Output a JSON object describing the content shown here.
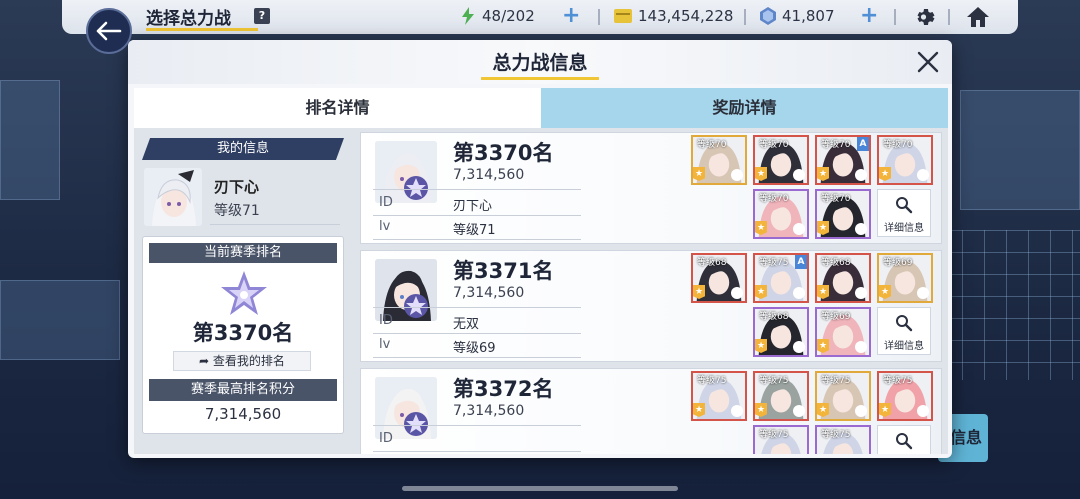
{
  "topbar": {
    "title": "选择总力战",
    "help": "?",
    "stamina": "48/202",
    "credits": "143,454,228",
    "gems": "41,807"
  },
  "modal": {
    "title": "总力战信息",
    "tabs": [
      {
        "label": "排名详情",
        "active": true
      },
      {
        "label": "奖励详情",
        "active": false
      }
    ]
  },
  "my_info": {
    "header": "我的信息",
    "name": "刃下心",
    "level": "等级71",
    "season_rank_header": "当前赛季排名",
    "season_rank": "第3370名",
    "view_button": "查看我的排名",
    "best_header": "赛季最高排名积分",
    "best_score": "7,314,560"
  },
  "rank_list": [
    {
      "rank": "第3370名",
      "score": "7,314,560",
      "id_label": "ID",
      "id_value": "刃下心",
      "lv_label": "lv",
      "lv_value": "等级71",
      "characters": [
        {
          "level": "等级70",
          "border": "#e0a93a",
          "color": "#d8c6b5"
        },
        {
          "level": "等级70",
          "border": "#d5544a",
          "color": "#2f2f3a"
        },
        {
          "level": "等级70",
          "border": "#d5544a",
          "color": "#3a2d3a",
          "badge": "A"
        },
        {
          "level": "等级70",
          "border": "#d5544a",
          "color": "#cfd5e6"
        },
        {
          "level": "等级70",
          "border": "#9b6ad0",
          "color": "#f0b4bb"
        },
        {
          "level": "等级70",
          "border": "#9b6ad0",
          "color": "#25262d"
        }
      ],
      "detail": "详细信息"
    },
    {
      "rank": "第3371名",
      "score": "7,314,560",
      "id_label": "ID",
      "id_value": "无双",
      "lv_label": "lv",
      "lv_value": "等级69",
      "characters": [
        {
          "level": "等级68",
          "border": "#d5544a",
          "color": "#2f2f3a"
        },
        {
          "level": "等级75",
          "border": "#d5544a",
          "color": "#cfd5e6",
          "badge": "A"
        },
        {
          "level": "等级68",
          "border": "#d5544a",
          "color": "#3a2d3a"
        },
        {
          "level": "等级69",
          "border": "#e0a93a",
          "color": "#d8c6b5"
        },
        {
          "level": "等级68",
          "border": "#9b6ad0",
          "color": "#25262d"
        },
        {
          "level": "等级69",
          "border": "#9b6ad0",
          "color": "#f0b4bb"
        }
      ],
      "detail": "详细信息"
    },
    {
      "rank": "第3372名",
      "score": "7,314,560",
      "id_label": "ID",
      "id_value": "",
      "lv_label": "",
      "lv_value": "",
      "characters": [
        {
          "level": "等级75",
          "border": "#d5544a",
          "color": "#cfd5e6"
        },
        {
          "level": "等级75",
          "border": "#d5544a",
          "color": "#9aa3a0"
        },
        {
          "level": "等级75",
          "border": "#e0a93a",
          "color": "#d8c6b5"
        },
        {
          "level": "等级75",
          "border": "#d5544a",
          "color": "#f0a2a8"
        },
        {
          "level": "等级75",
          "border": "#9b6ad0",
          "color": "#cfd5e6"
        },
        {
          "level": "等级75",
          "border": "#9b6ad0",
          "color": "#cfd5e6"
        }
      ],
      "detail": ""
    }
  ],
  "background": {
    "side_button": "信息"
  }
}
